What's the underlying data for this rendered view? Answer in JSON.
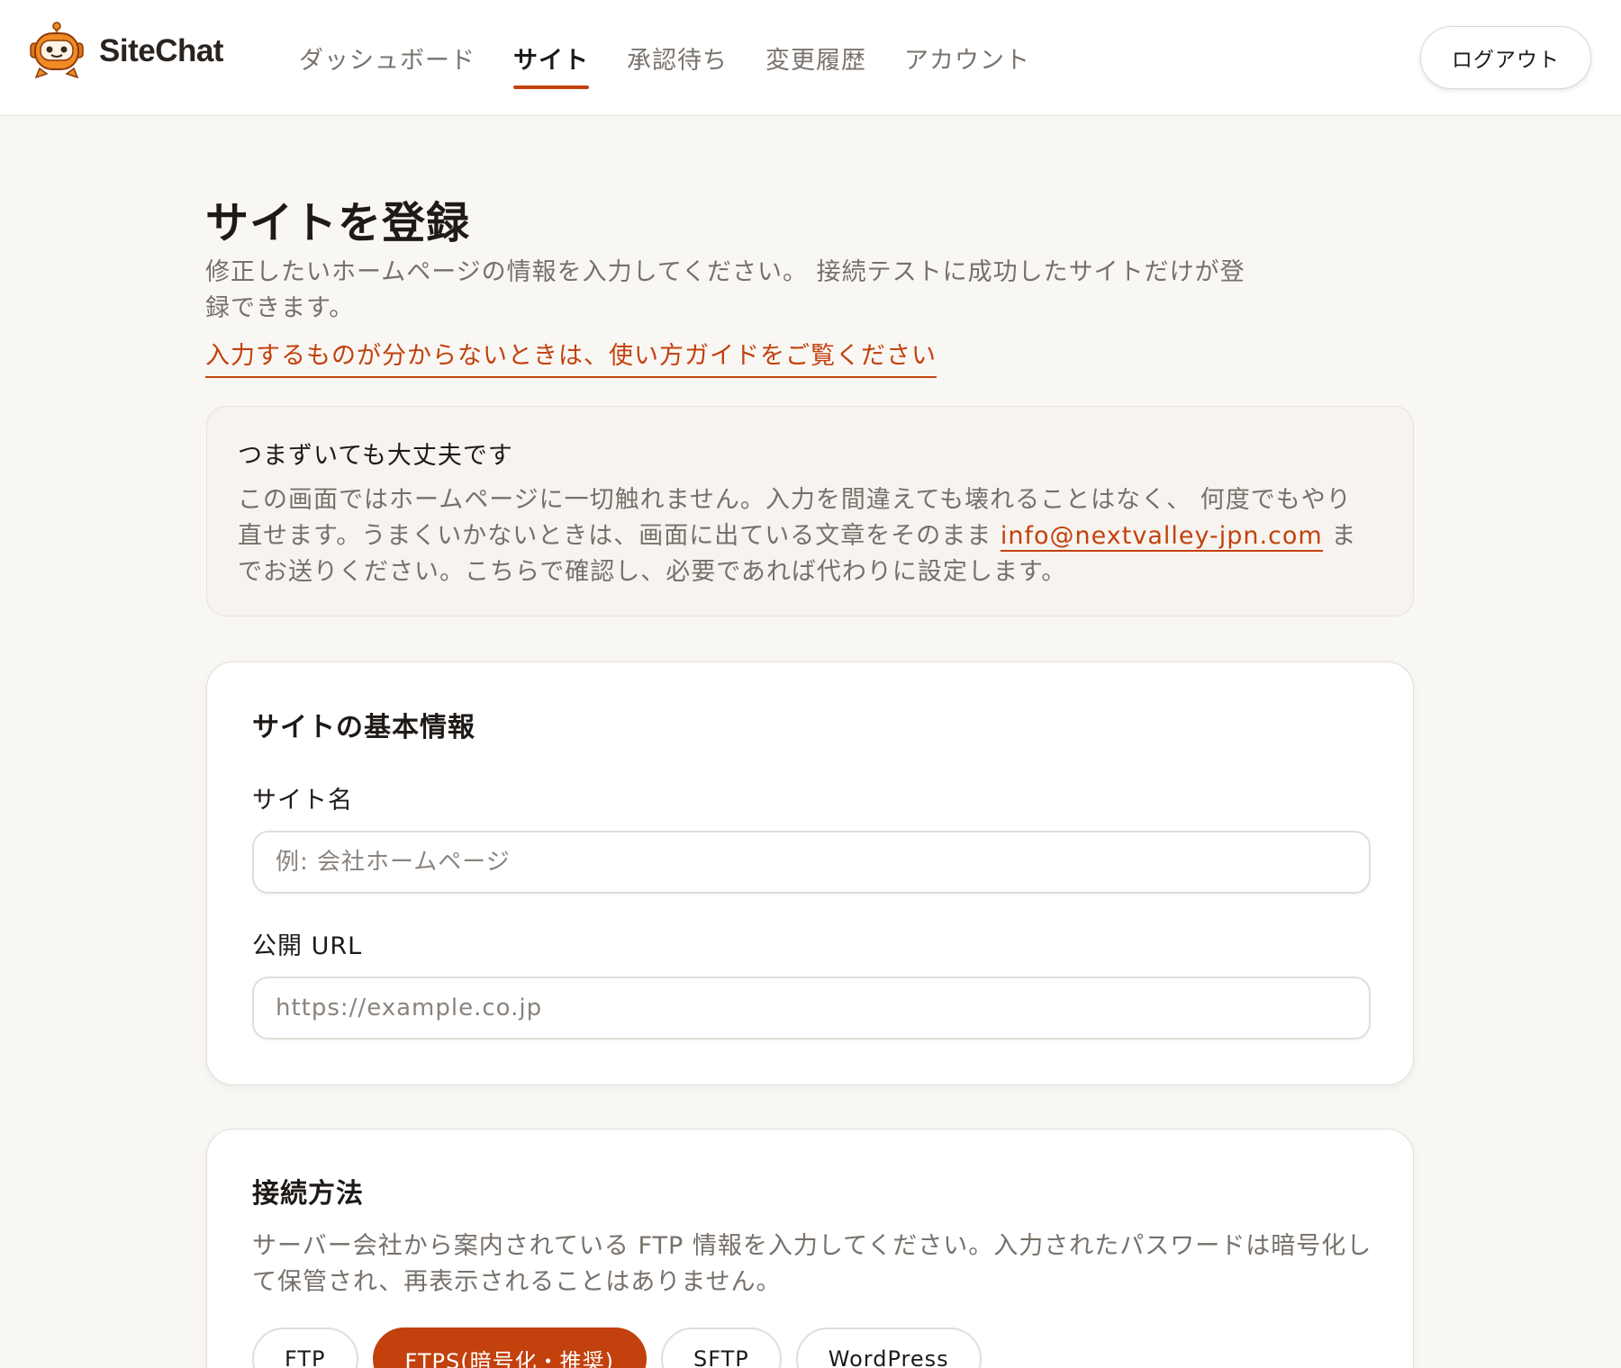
{
  "app": {
    "name": "SiteChat"
  },
  "nav": {
    "items": [
      {
        "label": "ダッシュボード",
        "active": false
      },
      {
        "label": "サイト",
        "active": true
      },
      {
        "label": "承認待ち",
        "active": false
      },
      {
        "label": "変更履歴",
        "active": false
      },
      {
        "label": "アカウント",
        "active": false
      }
    ],
    "logout_label": "ログアウト"
  },
  "page": {
    "title": "サイトを登録",
    "description": "修正したいホームページの情報を入力してください。 接続テストに成功したサイトだけが登録できます。",
    "guide_link": "入力するものが分からないときは、使い方ガイドをご覧ください"
  },
  "notice": {
    "title": "つまずいても大丈夫です",
    "body_before": "この画面ではホームページに一切触れません。入力を間違えても壊れることはなく、 何度でもやり直せます。うまくいかないときは、画面に出ている文章をそのまま ",
    "email": "info@nextvalley-jpn.com",
    "body_after": " までお送りください。こちらで確認し、必要であれば代わりに設定します。"
  },
  "basic_info": {
    "title": "サイトの基本情報",
    "site_name_label": "サイト名",
    "site_name_value": "",
    "site_name_placeholder": "例: 会社ホームページ",
    "url_label": "公開 URL",
    "url_value": "",
    "url_placeholder": "https://example.co.jp"
  },
  "connection": {
    "title": "接続方法",
    "description": "サーバー会社から案内されている FTP 情報を入力してください。入力されたパスワードは暗号化して保管され、再表示されることはありません。",
    "methods": [
      {
        "label": "FTP",
        "active": false
      },
      {
        "label": "FTPS(暗号化・推奨)",
        "active": true
      },
      {
        "label": "SFTP",
        "active": false
      },
      {
        "label": "WordPress",
        "active": false
      }
    ]
  },
  "colors": {
    "accent": "#c2410c",
    "background": "#f9f7f4",
    "text_primary": "#1f1a17",
    "text_muted": "#77706a"
  }
}
